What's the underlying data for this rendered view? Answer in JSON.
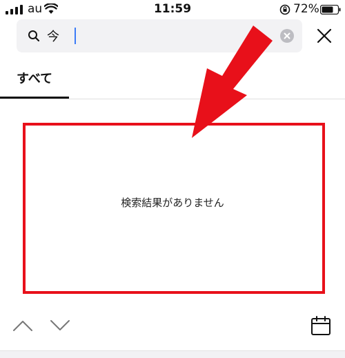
{
  "status_bar": {
    "carrier": "au",
    "time": "11:59",
    "battery_percent": "72%",
    "signal_bars": 4,
    "icons": [
      "signal-icon",
      "wifi-icon",
      "orientation-lock-icon",
      "battery-icon"
    ]
  },
  "search": {
    "value": "今",
    "icon": "search-icon",
    "clear_icon": "clear-icon"
  },
  "close_icon": "close-icon",
  "tabs": [
    {
      "label": "すべて",
      "selected": true
    }
  ],
  "results": {
    "empty_message": "検索結果がありません"
  },
  "annotation": {
    "color": "#e8101a",
    "shapes": [
      "red-arrow",
      "red-highlight-box"
    ]
  },
  "toolbar": {
    "icons": [
      "chevron-up-icon",
      "chevron-down-icon",
      "calendar-icon"
    ]
  },
  "colors": {
    "search_bg": "#f2f2f4",
    "caret": "#3b7bf7",
    "annotation_red": "#e8101a"
  }
}
